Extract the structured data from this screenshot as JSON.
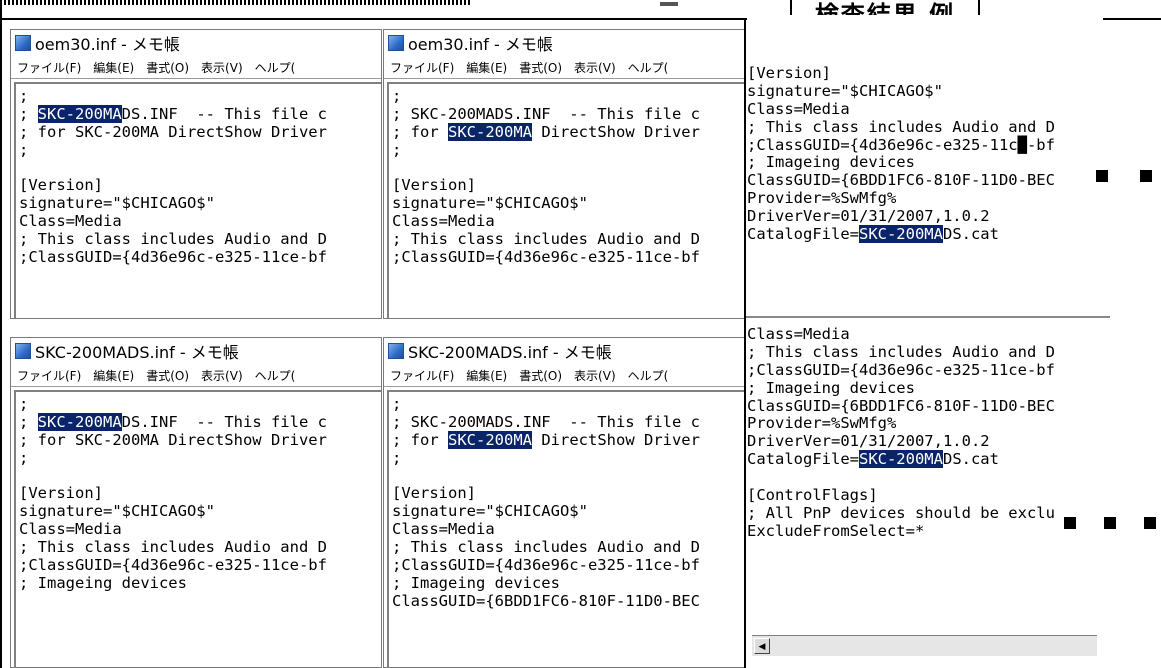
{
  "header_label": "検査結果 例",
  "top_semicolon": ";",
  "windows": [
    {
      "title": "oem30.inf - メモ帳",
      "menu": [
        "ファイル(F)",
        "編集(E)",
        "書式(O)",
        "表示(V)",
        "ヘルプ("
      ],
      "lines": [
        [
          {
            "t": ";"
          }
        ],
        [
          {
            "t": "; "
          },
          {
            "t": "SKC-200MA",
            "hl": true
          },
          {
            "t": "DS.INF  -- This file c"
          }
        ],
        [
          {
            "t": "; for SKC-200MA DirectShow Driver"
          }
        ],
        [
          {
            "t": ";"
          }
        ],
        [
          {
            "t": ""
          }
        ],
        [
          {
            "t": "[Version]"
          }
        ],
        [
          {
            "t": "signature=\"$CHICAGO$\""
          }
        ],
        [
          {
            "t": "Class=Media"
          }
        ],
        [
          {
            "t": "; This class includes Audio and D"
          }
        ],
        [
          {
            "t": ";ClassGUID={4d36e96c-e325-11ce-bf"
          }
        ]
      ]
    },
    {
      "title": "oem30.inf - メモ帳",
      "menu": [
        "ファイル(F)",
        "編集(E)",
        "書式(O)",
        "表示(V)",
        "ヘルプ("
      ],
      "lines": [
        [
          {
            "t": ";"
          }
        ],
        [
          {
            "t": "; SKC-200MADS.INF  -- This file c"
          }
        ],
        [
          {
            "t": "; for "
          },
          {
            "t": "SKC-200MA",
            "hl": true
          },
          {
            "t": " DirectShow Driver"
          }
        ],
        [
          {
            "t": ";"
          }
        ],
        [
          {
            "t": ""
          }
        ],
        [
          {
            "t": "[Version]"
          }
        ],
        [
          {
            "t": "signature=\"$CHICAGO$\""
          }
        ],
        [
          {
            "t": "Class=Media"
          }
        ],
        [
          {
            "t": "; This class includes Audio and D"
          }
        ],
        [
          {
            "t": ";ClassGUID={4d36e96c-e325-11ce-bf"
          }
        ]
      ]
    },
    {
      "title": "SKC-200MADS.inf - メモ帳",
      "menu": [
        "ファイル(F)",
        "編集(E)",
        "書式(O)",
        "表示(V)",
        "ヘルプ("
      ],
      "lines": [
        [
          {
            "t": ";"
          }
        ],
        [
          {
            "t": "; "
          },
          {
            "t": "SKC-200MA",
            "hl": true
          },
          {
            "t": "DS.INF  -- This file c"
          }
        ],
        [
          {
            "t": "; for SKC-200MA DirectShow Driver"
          }
        ],
        [
          {
            "t": ";"
          }
        ],
        [
          {
            "t": ""
          }
        ],
        [
          {
            "t": "[Version]"
          }
        ],
        [
          {
            "t": "signature=\"$CHICAGO$\""
          }
        ],
        [
          {
            "t": "Class=Media"
          }
        ],
        [
          {
            "t": "; This class includes Audio and D"
          }
        ],
        [
          {
            "t": ";ClassGUID={4d36e96c-e325-11ce-bf"
          }
        ],
        [
          {
            "t": "; Imageing devices"
          }
        ]
      ]
    },
    {
      "title": "SKC-200MADS.inf - メモ帳",
      "menu": [
        "ファイル(F)",
        "編集(E)",
        "書式(O)",
        "表示(V)",
        "ヘルプ("
      ],
      "lines": [
        [
          {
            "t": ";"
          }
        ],
        [
          {
            "t": "; SKC-200MADS.INF  -- This file c"
          }
        ],
        [
          {
            "t": "; for "
          },
          {
            "t": "SKC-200MA",
            "hl": true
          },
          {
            "t": " DirectShow Driver"
          }
        ],
        [
          {
            "t": ";"
          }
        ],
        [
          {
            "t": ""
          }
        ],
        [
          {
            "t": "[Version]"
          }
        ],
        [
          {
            "t": "signature=\"$CHICAGO$\""
          }
        ],
        [
          {
            "t": "Class=Media"
          }
        ],
        [
          {
            "t": "; This class includes Audio and D"
          }
        ],
        [
          {
            "t": ";ClassGUID={4d36e96c-e325-11ce-bf"
          }
        ],
        [
          {
            "t": "; Imageing devices"
          }
        ],
        [
          {
            "t": "ClassGUID={6BDD1FC6-810F-11D0-BEC"
          }
        ]
      ]
    }
  ],
  "right_top_lines": [
    [
      {
        "t": "[Version]"
      }
    ],
    [
      {
        "t": "signature=\"$CHICAGO$\""
      }
    ],
    [
      {
        "t": "Class=Media"
      }
    ],
    [
      {
        "t": "; This class includes Audio and D"
      }
    ],
    [
      {
        "t": ";ClassGUID={4d36e96c-e325-11c"
      },
      {
        "t": "█",
        "hl": false
      },
      {
        "t": "-bf"
      }
    ],
    [
      {
        "t": "; Imageing devices"
      }
    ],
    [
      {
        "t": "ClassGUID={6BDD1FC6-810F-11D0-BEC"
      }
    ],
    [
      {
        "t": "Provider=%SwMfg%"
      }
    ],
    [
      {
        "t": "DriverVer=01/31/2007,1.0.2"
      }
    ],
    [
      {
        "t": "CatalogFile="
      },
      {
        "t": "SKC-200MA",
        "hl": true
      },
      {
        "t": "DS.cat"
      }
    ]
  ],
  "right_bottom_lines": [
    [
      {
        "t": "Class=Media"
      }
    ],
    [
      {
        "t": "; This class includes Audio and D"
      }
    ],
    [
      {
        "t": ";ClassGUID={4d36e96c-e325-11ce-bf"
      }
    ],
    [
      {
        "t": "; Imageing devices"
      }
    ],
    [
      {
        "t": "ClassGUID={6BDD1FC6-810F-11D0-BEC"
      }
    ],
    [
      {
        "t": "Provider=%SwMfg%"
      }
    ],
    [
      {
        "t": "DriverVer=01/31/2007,1.0.2"
      }
    ],
    [
      {
        "t": "CatalogFile="
      },
      {
        "t": "SKC-200MA",
        "hl": true
      },
      {
        "t": "DS.cat"
      }
    ],
    [
      {
        "t": ""
      }
    ],
    [
      {
        "t": "[ControlFlags]"
      }
    ],
    [
      {
        "t": "; All PnP devices should be exclu"
      }
    ],
    [
      {
        "t": "ExcludeFromSelect=*"
      }
    ]
  ],
  "scrollbar_arrow": "◀",
  "colors": {
    "highlight_bg": "#0a246a",
    "highlight_fg": "#ffffff",
    "icon": "#2e6bc6"
  }
}
